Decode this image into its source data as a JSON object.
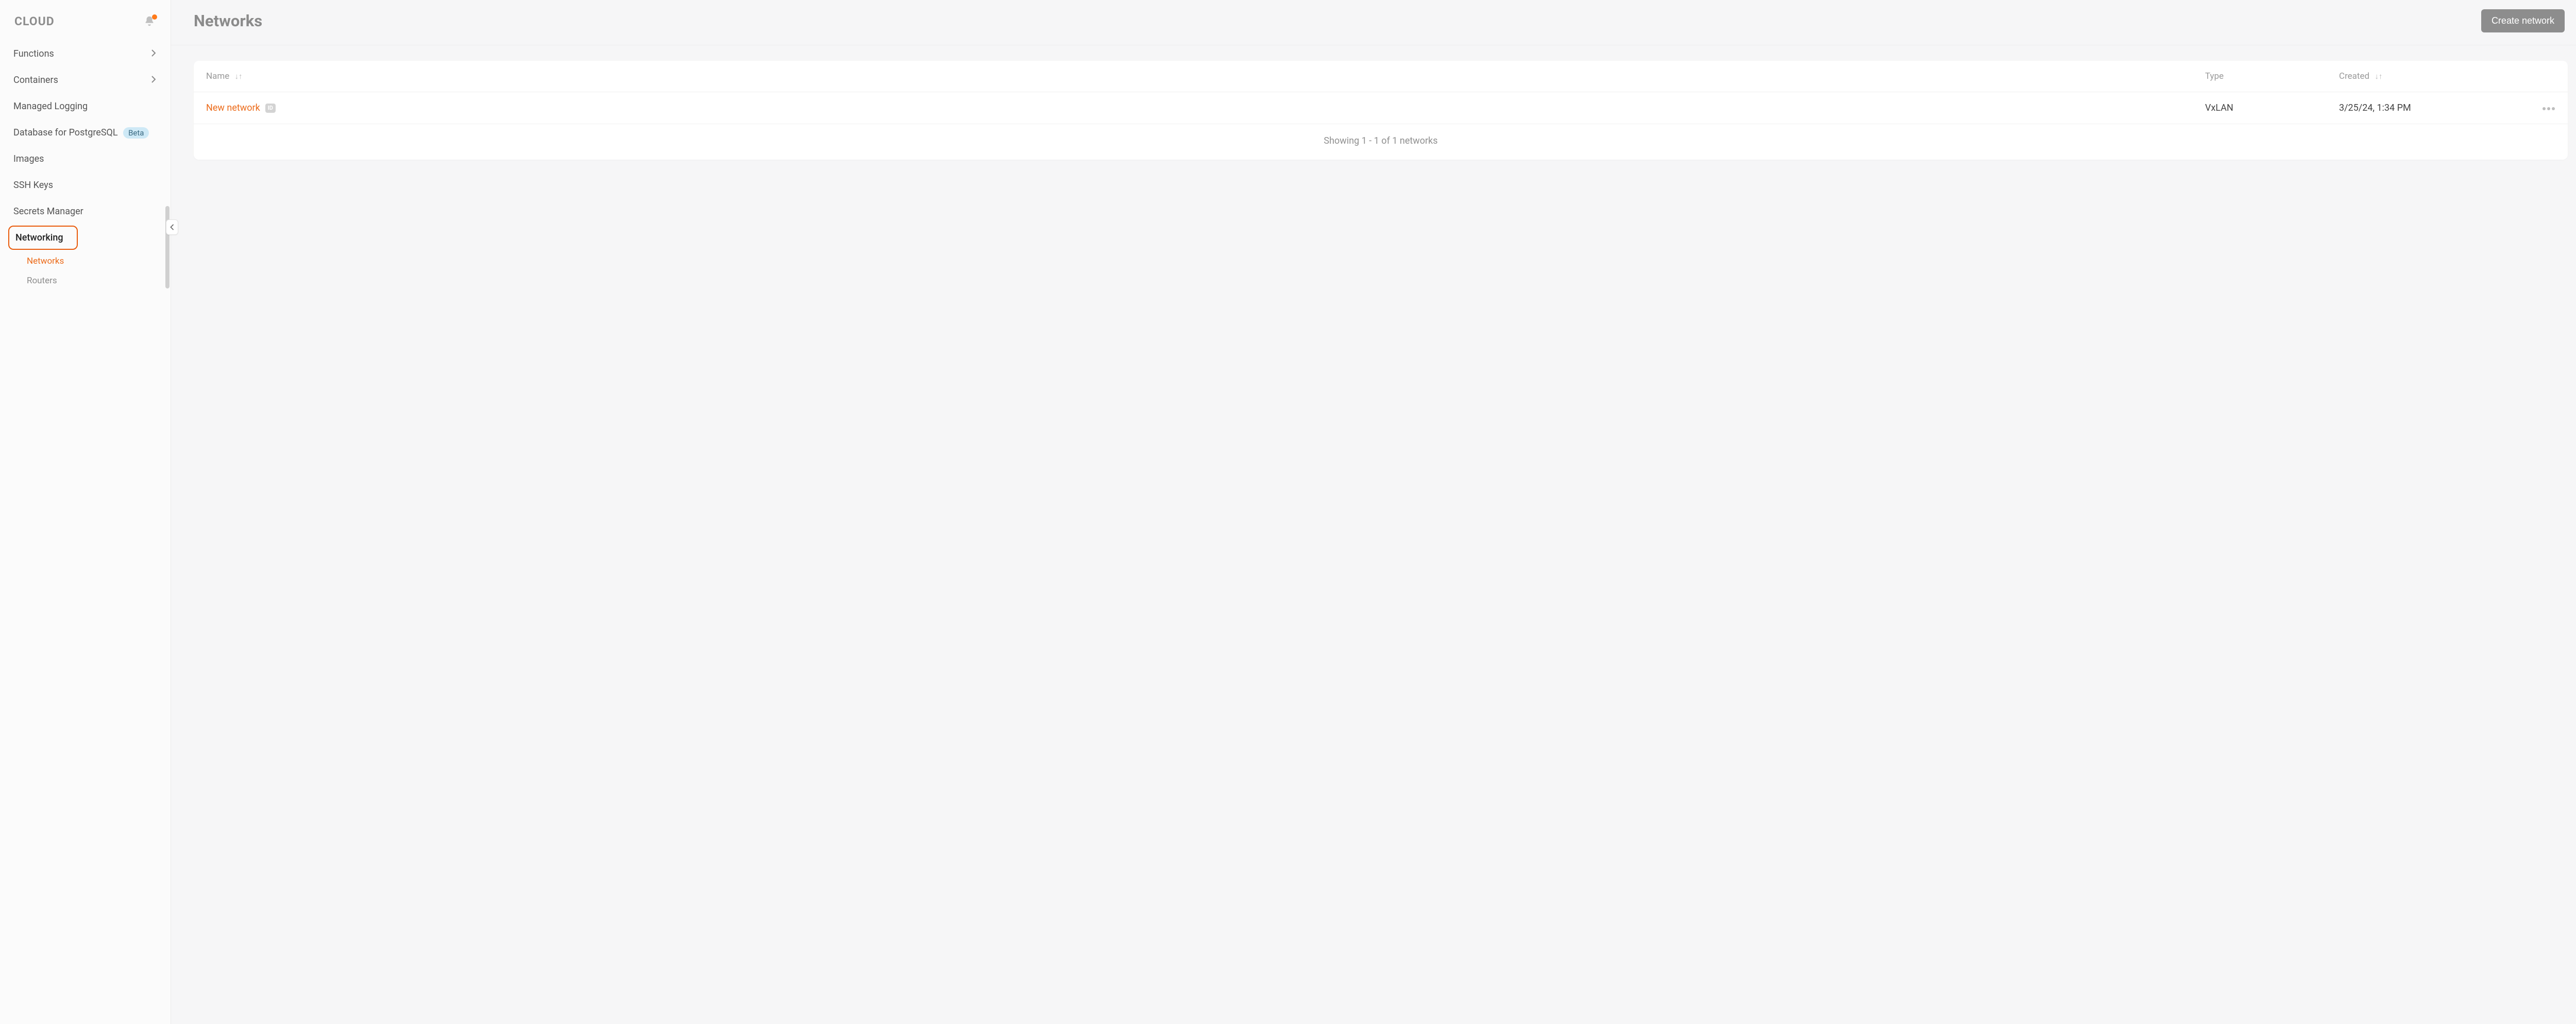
{
  "brand": "CLOUD",
  "sidebar": {
    "items": [
      {
        "label": "Functions",
        "expandable": true
      },
      {
        "label": "Containers",
        "expandable": true
      },
      {
        "label": "Managed Logging",
        "expandable": false
      },
      {
        "label": "Database for PostgreSQL",
        "expandable": false,
        "badge": "Beta"
      },
      {
        "label": "Images",
        "expandable": false
      },
      {
        "label": "SSH Keys",
        "expandable": false
      },
      {
        "label": "Secrets Manager",
        "expandable": false
      },
      {
        "label": "Networking",
        "expandable": true,
        "expanded": true
      }
    ],
    "networking_children": [
      {
        "label": "Networks",
        "active": true
      },
      {
        "label": "Routers",
        "active": false
      }
    ]
  },
  "page": {
    "title": "Networks",
    "create_button": "Create network"
  },
  "table": {
    "columns": {
      "name": "Name",
      "type": "Type",
      "created": "Created"
    },
    "sort_glyph": "↓↑",
    "rows": [
      {
        "name": "New network",
        "id_badge": "ID",
        "type": "VxLAN",
        "created": "3/25/24, 1:34 PM"
      }
    ],
    "footer": "Showing 1 - 1 of 1 networks"
  }
}
